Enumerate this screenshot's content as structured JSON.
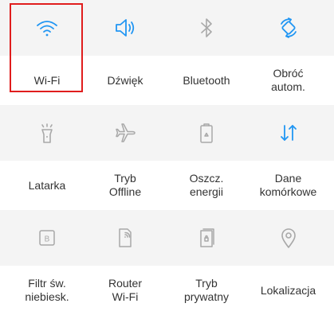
{
  "colors": {
    "active": "#2196f3",
    "inactive": "#a8a8a8",
    "highlight": "#e01d1d",
    "tile_background": "#f4f4f4",
    "label_text": "#333333"
  },
  "tiles": [
    {
      "label": "Wi-Fi",
      "icon": "wifi-icon",
      "state": "active"
    },
    {
      "label": "Dźwięk",
      "icon": "sound-icon",
      "state": "active"
    },
    {
      "label": "Bluetooth",
      "icon": "bluetooth-icon",
      "state": "inactive"
    },
    {
      "label": "Obróć\nautom.",
      "icon": "auto-rotate-icon",
      "state": "active"
    },
    {
      "label": "Latarka",
      "icon": "flashlight-icon",
      "state": "inactive"
    },
    {
      "label": "Tryb\nOffline",
      "icon": "airplane-icon",
      "state": "inactive"
    },
    {
      "label": "Oszcz.\nenergii",
      "icon": "power-saving-icon",
      "state": "inactive"
    },
    {
      "label": "Dane\nkomórkowe",
      "icon": "mobile-data-icon",
      "state": "active"
    },
    {
      "label": "Filtr św.\nniebiesk.",
      "icon": "blue-light-filter-icon",
      "state": "inactive"
    },
    {
      "label": "Router\nWi-Fi",
      "icon": "mobile-hotspot-icon",
      "state": "inactive"
    },
    {
      "label": "Tryb\nprywatny",
      "icon": "private-mode-icon",
      "state": "inactive"
    },
    {
      "label": "Lokalizacja",
      "icon": "location-icon",
      "state": "inactive"
    }
  ]
}
